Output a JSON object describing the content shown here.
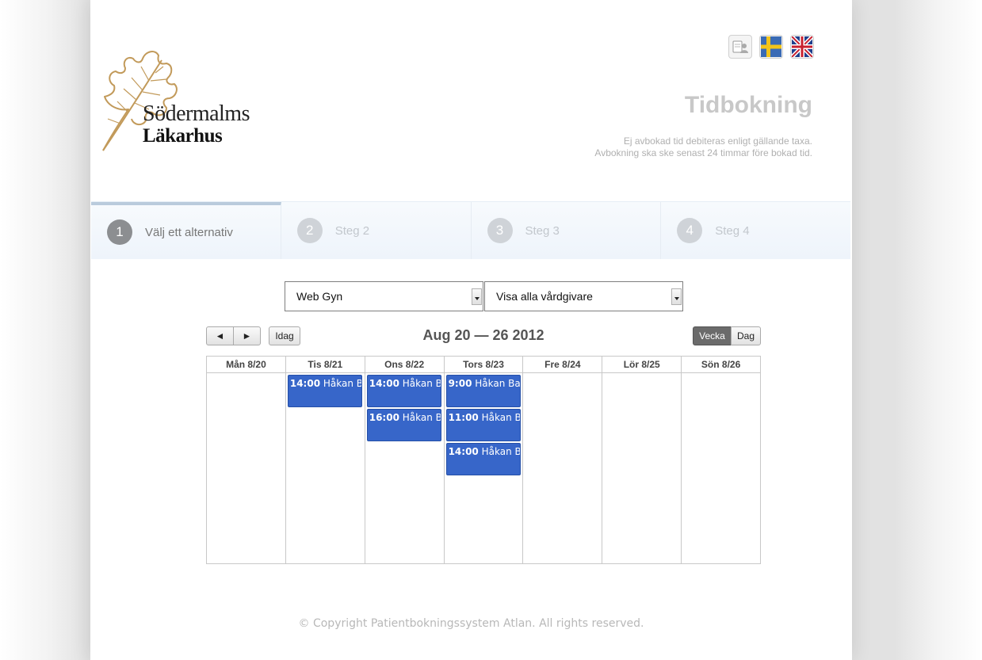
{
  "brand": {
    "line1": "Södermalms",
    "line2": "Läkarhus"
  },
  "top_icons": [
    "contact-card-icon",
    "swedish-flag-icon",
    "uk-flag-icon"
  ],
  "page_title": "Tidbokning",
  "notice": {
    "line1": "Ej avbokad tid debiteras enligt gällande taxa.",
    "line2": "Avbokning ska ske senast 24 timmar före bokad tid."
  },
  "steps": [
    {
      "num": "1",
      "label": "Välj ett alternativ",
      "active": true
    },
    {
      "num": "2",
      "label": "Steg 2",
      "active": false
    },
    {
      "num": "3",
      "label": "Steg 3",
      "active": false
    },
    {
      "num": "4",
      "label": "Steg 4",
      "active": false
    }
  ],
  "filters": {
    "service": "Web Gyn",
    "provider": "Visa alla vårdgivare"
  },
  "calendar": {
    "prev": "◄",
    "next": "►",
    "today_label": "Idag",
    "title": "Aug 20 — 26 2012",
    "view_week": "Vecka",
    "view_day": "Dag",
    "days": [
      {
        "label": "Mån 8/20",
        "events": []
      },
      {
        "label": "Tis 8/21",
        "events": [
          {
            "time": "14:00",
            "name": "Håkan Baehrendtz"
          }
        ]
      },
      {
        "label": "Ons 8/22",
        "events": [
          {
            "time": "14:00",
            "name": "Håkan Baehrendtz"
          },
          {
            "time": "16:00",
            "name": "Håkan Baehrendtz"
          }
        ]
      },
      {
        "label": "Tors 8/23",
        "events": [
          {
            "time": "9:00",
            "name": "Håkan Baehrendtz"
          },
          {
            "time": "11:00",
            "name": "Håkan Baehrendtz"
          },
          {
            "time": "14:00",
            "name": "Håkan Baehrendtz"
          }
        ]
      },
      {
        "label": "Fre 8/24",
        "events": []
      },
      {
        "label": "Lör 8/25",
        "events": []
      },
      {
        "label": "Sön 8/26",
        "events": []
      }
    ]
  },
  "footer": "© Copyright Patientbokningssystem Atlan. All rights reserved.",
  "colors": {
    "event_bg": "#3766c9",
    "active_view": "#6b6b6b",
    "title_gray": "#c8c8c8",
    "logo_leaf": "#c29a5a"
  }
}
